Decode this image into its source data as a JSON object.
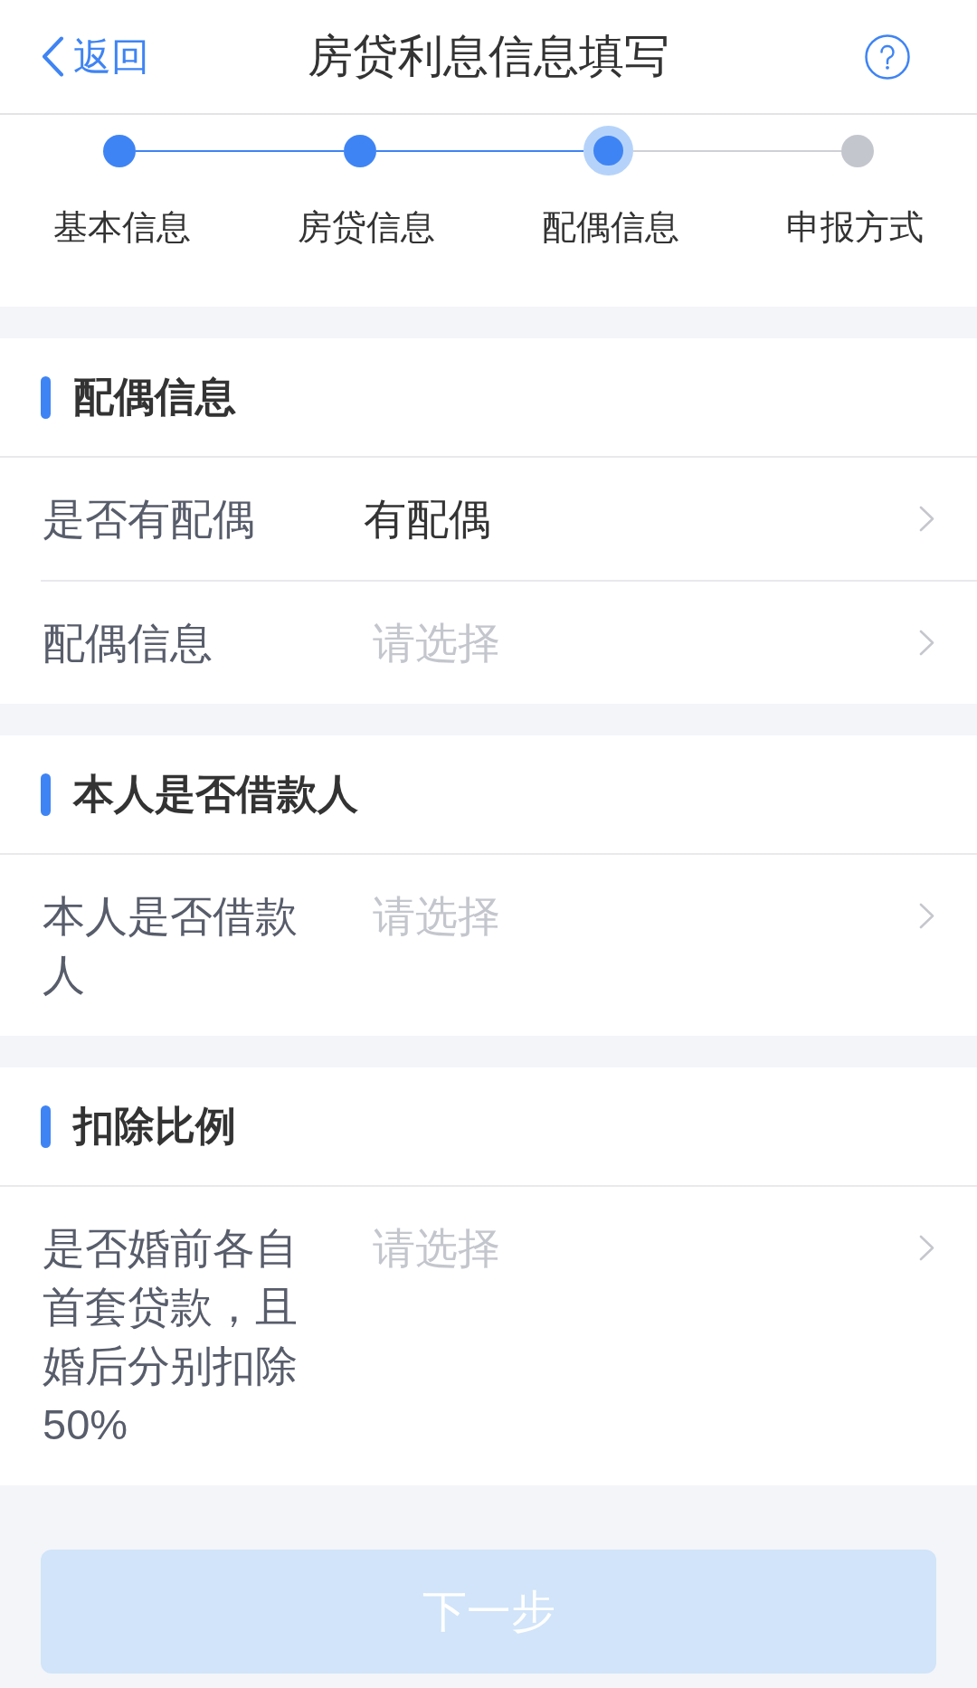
{
  "nav": {
    "back_label": "返回",
    "title": "房贷利息信息填写"
  },
  "steps": [
    {
      "label": "基本信息",
      "reached": true,
      "current": false
    },
    {
      "label": "房贷信息",
      "reached": true,
      "current": false
    },
    {
      "label": "配偶信息",
      "reached": true,
      "current": true
    },
    {
      "label": "申报方式",
      "reached": false,
      "current": false
    }
  ],
  "sections": [
    {
      "title": "配偶信息",
      "rows": [
        {
          "label": "是否有配偶",
          "value": "有配偶"
        },
        {
          "label": "配偶信息",
          "placeholder": "请选择"
        }
      ]
    },
    {
      "title": "本人是否借款人",
      "rows": [
        {
          "label": "本人是否借款人",
          "placeholder": "请选择"
        }
      ]
    },
    {
      "title": "扣除比例",
      "rows": [
        {
          "label": "是否婚前各自首套贷款，且婚后分别扣除50%",
          "placeholder": "请选择"
        }
      ]
    }
  ],
  "next_button": {
    "label": "下一步",
    "disabled": true
  }
}
